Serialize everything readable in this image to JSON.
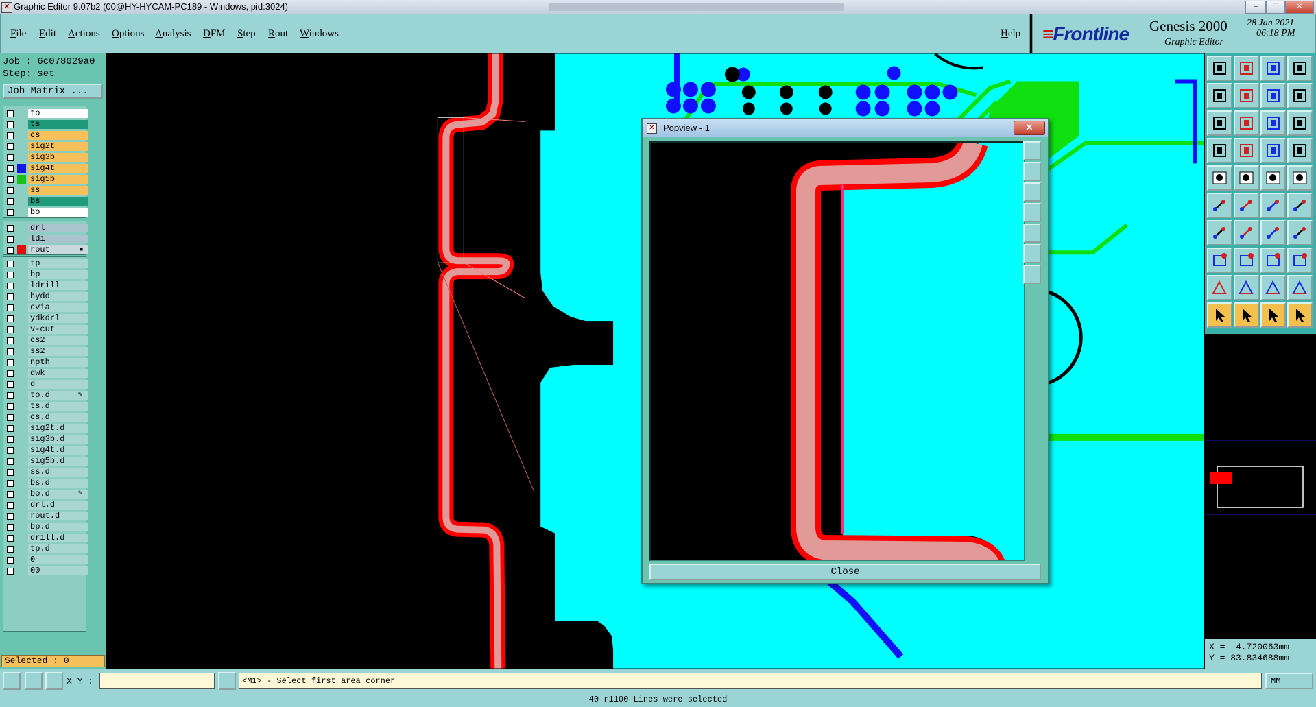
{
  "window": {
    "title": "Graphic Editor 9.07b2 (00@HY-HYCAM-PC189 - Windows, pid:3024)",
    "controls": [
      "–",
      "❐",
      "✕"
    ]
  },
  "menu": {
    "items": [
      "File",
      "Edit",
      "Actions",
      "Options",
      "Analysis",
      "DFM",
      "Step",
      "Rout",
      "Windows"
    ],
    "help": "Help"
  },
  "brand": {
    "logo": "Frontline",
    "product": "Genesis 2000",
    "subtitle": "Graphic Editor",
    "date": "28 Jan 2021",
    "time": "06:18 PM"
  },
  "job": {
    "job_line": "Job : 6c078029a0",
    "step_line": "Step: set",
    "job_matrix_label": "Job Matrix ..."
  },
  "layers": {
    "board": [
      {
        "name": "to",
        "bg": "#ffffff",
        "swatch": ""
      },
      {
        "name": "ts",
        "bg": "#1f9a7a",
        "swatch": ""
      },
      {
        "name": "cs",
        "bg": "#f6c05a",
        "swatch": ""
      },
      {
        "name": "sig2t",
        "bg": "#f6c05a",
        "swatch": ""
      },
      {
        "name": "sig3b",
        "bg": "#f6c05a",
        "swatch": ""
      },
      {
        "name": "sig4t",
        "bg": "#f6c05a",
        "swatch": "#1818e0"
      },
      {
        "name": "sig5b",
        "bg": "#f6c05a",
        "swatch": "#18c018"
      },
      {
        "name": "ss",
        "bg": "#f6c05a",
        "swatch": ""
      },
      {
        "name": "bs",
        "bg": "#1f9a7a",
        "swatch": ""
      },
      {
        "name": "bo",
        "bg": "#ffffff",
        "swatch": ""
      }
    ],
    "drill": [
      {
        "name": "drl",
        "bg": "#a9c4cc",
        "swatch": ""
      },
      {
        "name": "ldi",
        "bg": "#a9c4cc",
        "swatch": ""
      },
      {
        "name": "rout",
        "bg": "#c8d8dc",
        "swatch": "#e01010",
        "mark": "■"
      }
    ],
    "misc": [
      {
        "name": "tp"
      },
      {
        "name": "bp"
      },
      {
        "name": "ldrill"
      },
      {
        "name": "hydd"
      },
      {
        "name": "cvia"
      },
      {
        "name": "ydkdrl"
      },
      {
        "name": "v-cut"
      },
      {
        "name": "cs2"
      },
      {
        "name": "ss2"
      },
      {
        "name": "npth"
      },
      {
        "name": "dwk"
      },
      {
        "name": "d"
      },
      {
        "name": "to.d",
        "mark": "✎"
      },
      {
        "name": "ts.d"
      },
      {
        "name": "cs.d"
      },
      {
        "name": "sig2t.d"
      },
      {
        "name": "sig3b.d"
      },
      {
        "name": "sig4t.d"
      },
      {
        "name": "sig5b.d"
      },
      {
        "name": "ss.d"
      },
      {
        "name": "bs.d"
      },
      {
        "name": "bo.d",
        "mark": "✎"
      },
      {
        "name": "drl.d"
      },
      {
        "name": "rout.d"
      },
      {
        "name": "bp.d"
      },
      {
        "name": "drill.d"
      },
      {
        "name": "tp.d"
      },
      {
        "name": "0"
      },
      {
        "name": "00"
      }
    ],
    "selected_line": "Selected : 0"
  },
  "popview": {
    "title": "Popview - 1",
    "close_label": "Close",
    "close_x": "✕"
  },
  "coords": {
    "x_line": "X = -4.720063mm",
    "y_line": "Y = 83.834688mm"
  },
  "status": {
    "xy_label": "X Y :",
    "xy_value": "",
    "prompt": "<M1> - Select first area corner",
    "units": "MM",
    "message": "40 r1100 Lines were selected"
  },
  "colors": {
    "board": "#00ffff",
    "trace": "#10e010",
    "pad": "#1010ff",
    "rout": "#ff0000",
    "rout_fill": "#e29a98",
    "panel": "#9ad4d4"
  }
}
